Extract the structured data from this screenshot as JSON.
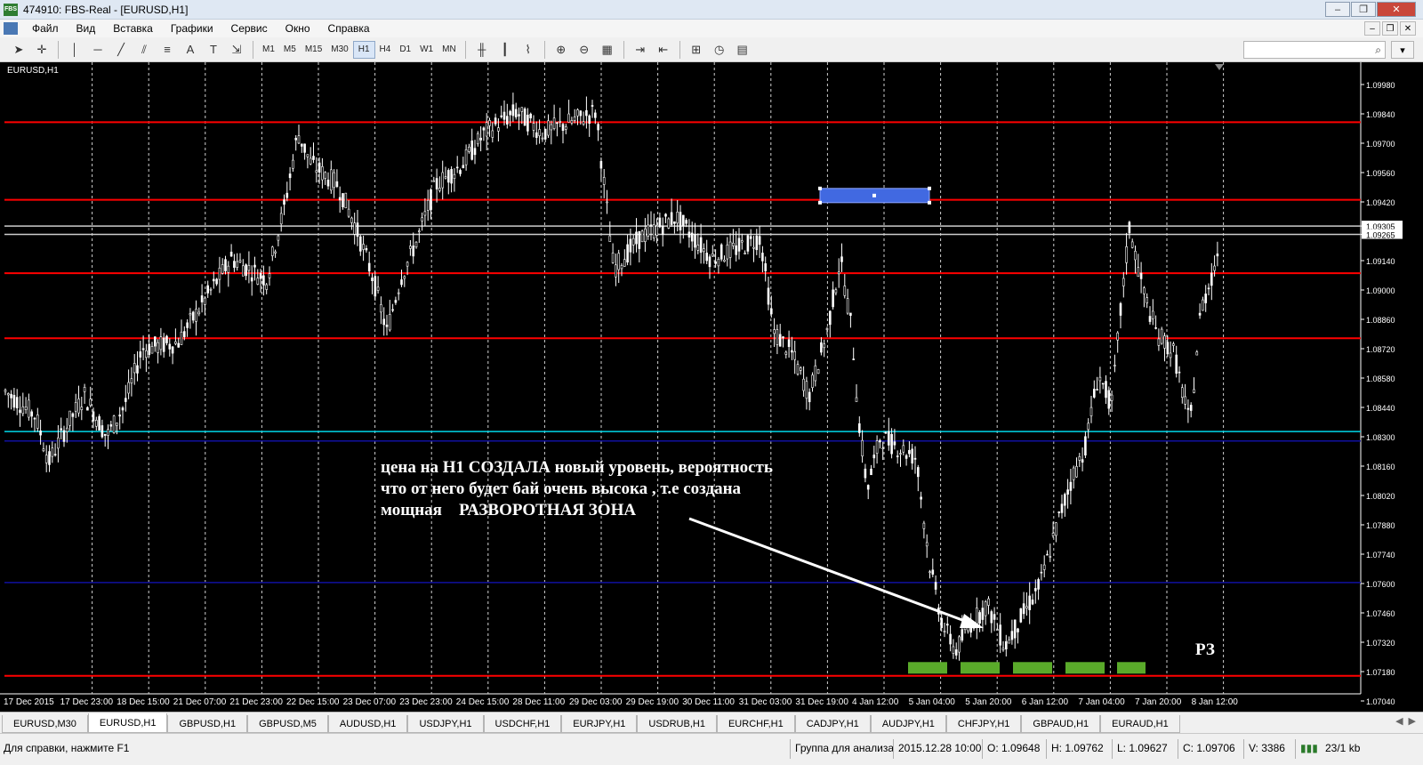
{
  "window": {
    "title": "474910: FBS-Real - [EURUSD,H1]",
    "logo": "FBS"
  },
  "menu": [
    "Файл",
    "Вид",
    "Вставка",
    "Графики",
    "Сервис",
    "Окно",
    "Справка"
  ],
  "timeframes": [
    "M1",
    "M5",
    "M15",
    "M30",
    "H1",
    "H4",
    "D1",
    "W1",
    "MN"
  ],
  "active_timeframe": "H1",
  "chart": {
    "label": "EURUSD,H1",
    "background": "#000000",
    "price_labels": [
      "1.09980",
      "1.09840",
      "1.09700",
      "1.09560",
      "1.09420",
      "1.09305",
      "1.09265",
      "1.09140",
      "1.09000",
      "1.08860",
      "1.08720",
      "1.08580",
      "1.08440",
      "1.08300",
      "1.08160",
      "1.08020",
      "1.07880",
      "1.07740",
      "1.07600",
      "1.07460",
      "1.07320",
      "1.07180",
      "1.07040"
    ],
    "time_labels": [
      "17 Dec 2015",
      "17 Dec 23:00",
      "18 Dec 15:00",
      "21 Dec 07:00",
      "21 Dec 23:00",
      "22 Dec 15:00",
      "23 Dec 07:00",
      "23 Dec 23:00",
      "24 Dec 15:00",
      "28 Dec 11:00",
      "29 Dec 03:00",
      "29 Dec 19:00",
      "30 Dec 11:00",
      "31 Dec 03:00",
      "31 Dec 19:00",
      "4 Jan 12:00",
      "5 Jan 04:00",
      "5 Jan 20:00",
      "6 Jan 12:00",
      "7 Jan 04:00",
      "7 Jan 20:00",
      "8 Jan 12:00"
    ],
    "annotation": "цена на H1 СОЗДАЛА новый уровень, вероятность\nчто от него будет бай очень высока , т.е создана\nмощная    РАЗВОРОТНАЯ ЗОНА",
    "zone_label": "РЗ",
    "level_colors": {
      "red": "#ff0000",
      "cyan": "#00d8e8",
      "navy": "#1010a0",
      "white": "#ffffff",
      "zone_box": "#4169e1",
      "green": "#5aaa2a"
    }
  },
  "tabs": [
    "EURUSD,M30",
    "EURUSD,H1",
    "GBPUSD,H1",
    "GBPUSD,M5",
    "AUDUSD,H1",
    "USDJPY,H1",
    "USDCHF,H1",
    "EURJPY,H1",
    "USDRUB,H1",
    "EURCHF,H1",
    "CADJPY,H1",
    "AUDJPY,H1",
    "CHFJPY,H1",
    "GBPAUD,H1",
    "EURAUD,H1"
  ],
  "active_tab": "EURUSD,H1",
  "status": {
    "help": "Для справки, нажмите F1",
    "profile": "Группа для анализа",
    "datetime": "2015.12.28 10:00",
    "open": "O: 1.09648",
    "high": "H: 1.09762",
    "low": "L: 1.09627",
    "close": "C: 1.09706",
    "volume": "V: 3386",
    "traffic": "23/1 kb"
  }
}
